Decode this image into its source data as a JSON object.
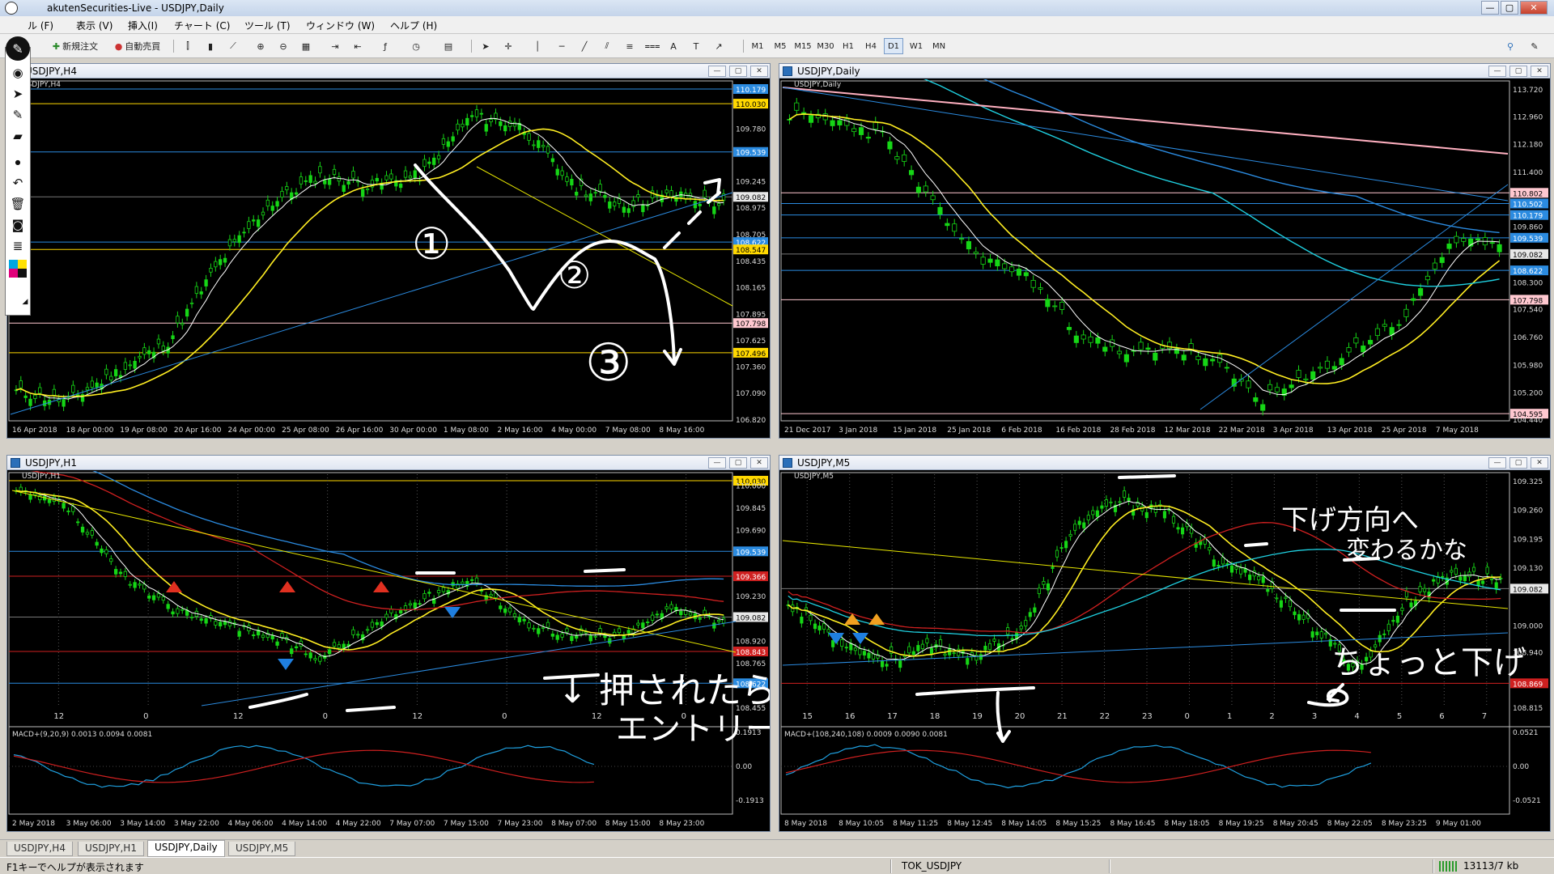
{
  "app": {
    "title": "akutenSecurities-Live - USDJPY,Daily",
    "btn_min": "—",
    "btn_max": "▢",
    "btn_close": "✕"
  },
  "menus": [
    "ル (F)",
    "表示 (V)",
    "挿入(I)",
    "チャート (C)",
    "ツール (T)",
    "ウィンドウ (W)",
    "ヘルプ (H)"
  ],
  "toolbar": {
    "new_order": "新規注文",
    "auto_trade": "自動売買",
    "timeframes": [
      "M1",
      "M5",
      "M15",
      "M30",
      "H1",
      "H4",
      "D1",
      "W1",
      "MN"
    ],
    "active_timeframe": "D1"
  },
  "windows": {
    "h4": {
      "title": "USDJPY,H4",
      "sub": "USDJPY,H4",
      "prices": [
        "110.179",
        "110.030",
        "109.780",
        "109.539",
        "109.245",
        "109.082",
        "108.975",
        "108.705",
        "108.622",
        "108.547",
        "108.435",
        "108.165",
        "107.895",
        "107.798",
        "107.625",
        "107.496",
        "107.360",
        "107.090",
        "106.820"
      ],
      "times": [
        "16 Apr 2018",
        "18 Apr 00:00",
        "19 Apr 08:00",
        "20 Apr 16:00",
        "24 Apr 00:00",
        "25 Apr 08:00",
        "26 Apr 16:00",
        "30 Apr 00:00",
        "1 May 08:00",
        "2 May 16:00",
        "4 May 00:00",
        "7 May 08:00",
        "8 May 16:00"
      ],
      "annotations": [
        "①",
        "②",
        "③"
      ]
    },
    "daily": {
      "title": "USDJPY,Daily",
      "sub": "USDJPY,Daily",
      "prices": [
        "113.720",
        "112.960",
        "112.180",
        "111.400",
        "110.802",
        "110.502",
        "110.179",
        "109.860",
        "109.539",
        "109.082",
        "108.622",
        "108.300",
        "107.798",
        "107.540",
        "106.760",
        "105.980",
        "105.200",
        "104.595",
        "104.440"
      ],
      "times": [
        "21 Dec 2017",
        "3 Jan 2018",
        "15 Jan 2018",
        "25 Jan 2018",
        "6 Feb 2018",
        "16 Feb 2018",
        "28 Feb 2018",
        "12 Mar 2018",
        "22 Mar 2018",
        "3 Apr 2018",
        "13 Apr 2018",
        "25 Apr 2018",
        "7 May 2018"
      ]
    },
    "h1": {
      "title": "USDJPY,H1",
      "sub": "USDJPY,H1",
      "prices": [
        "110.030",
        "110.000",
        "109.845",
        "109.690",
        "109.539",
        "109.366",
        "109.230",
        "109.082",
        "108.920",
        "108.843",
        "108.765",
        "108.622",
        "108.455"
      ],
      "grid_labels": [
        "12",
        "0",
        "12",
        "0",
        "12",
        "0",
        "12",
        "0"
      ],
      "times": [
        "2 May 2018",
        "3 May 06:00",
        "3 May 14:00",
        "3 May 22:00",
        "4 May 06:00",
        "4 May 14:00",
        "4 May 22:00",
        "7 May 07:00",
        "7 May 15:00",
        "7 May 23:00",
        "8 May 07:00",
        "8 May 15:00",
        "8 May 23:00"
      ],
      "macd_label": "MACD+(9,20,9) 0.0013 0.0094 0.0081",
      "macd_scale": [
        "0.1913",
        "0.00",
        "-0.1913"
      ],
      "annotations": [
        "↓ 押されたら",
        "エントリー"
      ]
    },
    "m5": {
      "title": "USDJPY,M5",
      "sub": "USDJPY,M5",
      "prices": [
        "109.325",
        "109.260",
        "109.195",
        "109.130",
        "109.082",
        "109.000",
        "108.940",
        "108.869",
        "108.815"
      ],
      "grid_labels": [
        "15",
        "16",
        "17",
        "18",
        "19",
        "20",
        "21",
        "22",
        "23",
        "0",
        "1",
        "2",
        "3",
        "4",
        "5",
        "6",
        "7"
      ],
      "times": [
        "8 May 2018",
        "8 May 10:05",
        "8 May 11:25",
        "8 May 12:45",
        "8 May 14:05",
        "8 May 15:25",
        "8 May 16:45",
        "8 May 18:05",
        "8 May 19:25",
        "8 May 20:45",
        "8 May 22:05",
        "8 May 23:25",
        "9 May 01:00"
      ],
      "macd_label": "MACD+(108,240,108) 0.0009 0.0090 0.0081",
      "macd_scale": [
        "0.0521",
        "0.00",
        "-0.0521"
      ],
      "annotations": [
        "下げ方向へ",
        "変わるかな",
        "ちょっと下げ"
      ]
    }
  },
  "tabs": [
    "USDJPY,H4",
    "USDJPY,H1",
    "USDJPY,Daily",
    "USDJPY,M5"
  ],
  "active_tab": "USDJPY,Daily",
  "status": {
    "help": "F1キーでヘルプが表示されます",
    "profile": "TOK_USDJPY",
    "traffic": "13113/7 kb"
  }
}
